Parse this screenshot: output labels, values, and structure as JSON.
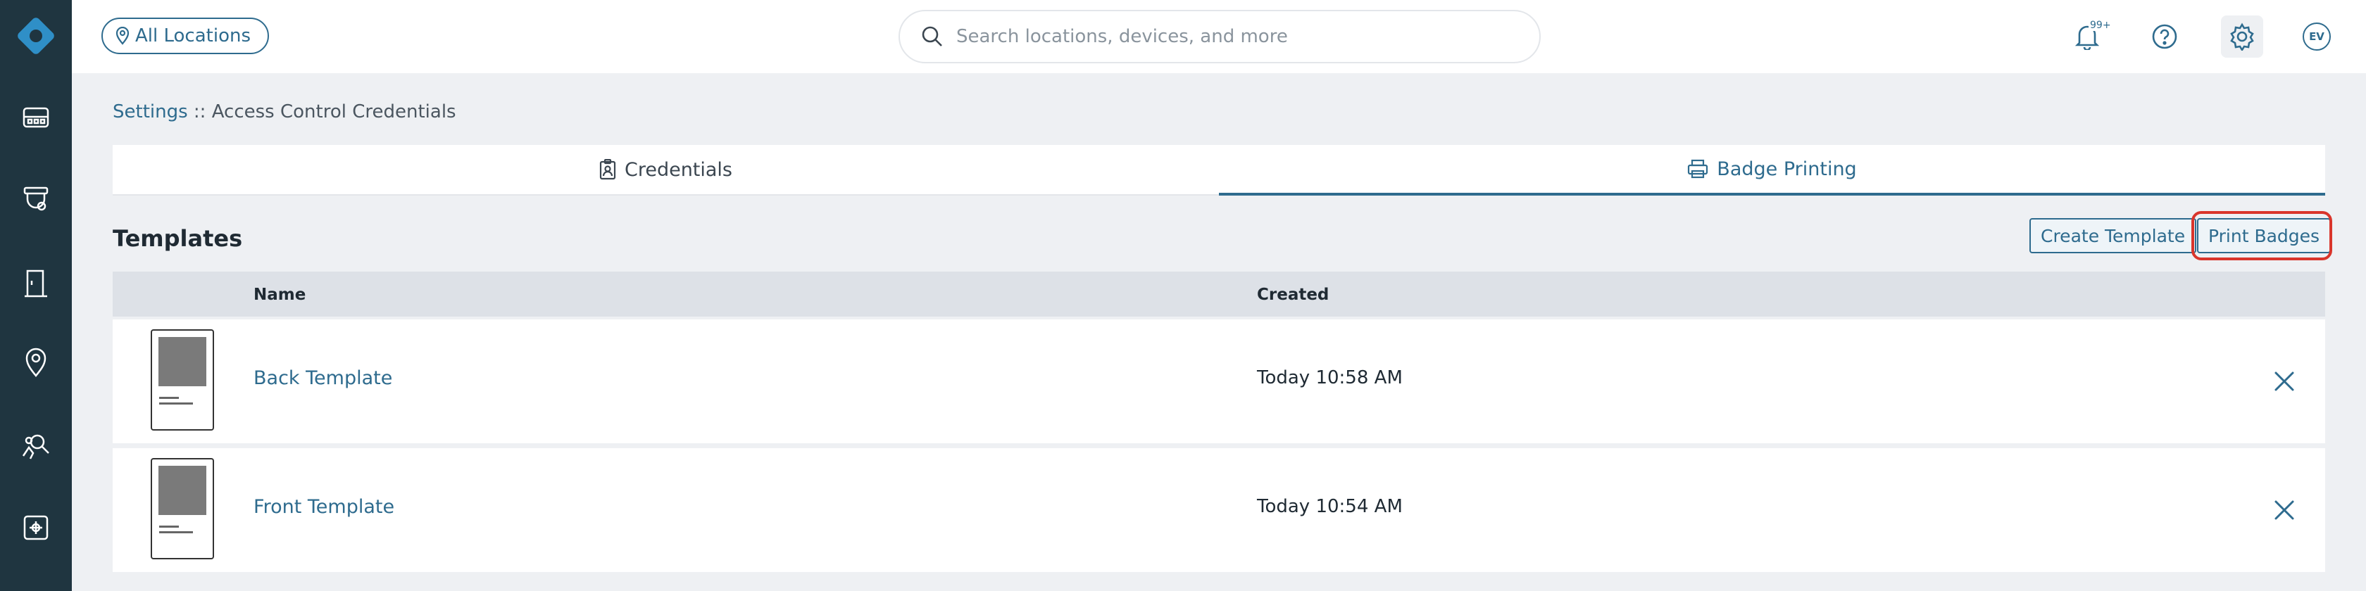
{
  "topbar": {
    "location_label": "All Locations",
    "search_placeholder": "Search locations, devices, and more",
    "notification_count": "99+",
    "avatar_initials": "EV"
  },
  "breadcrumb": {
    "root": "Settings",
    "separator": " :: ",
    "current": "Access Control Credentials"
  },
  "tabs": [
    {
      "label": "Credentials",
      "icon": "badge-icon",
      "active": false
    },
    {
      "label": "Badge Printing",
      "icon": "printer-icon",
      "active": true
    }
  ],
  "templates": {
    "title": "Templates",
    "create_label": "Create Template",
    "print_label": "Print Badges",
    "columns": {
      "name": "Name",
      "created": "Created"
    },
    "rows": [
      {
        "name": "Back Template",
        "created": "Today 10:58 AM"
      },
      {
        "name": "Front Template",
        "created": "Today 10:54 AM"
      }
    ]
  },
  "colors": {
    "sidebar": "#1f3540",
    "accent": "#2e6b8e",
    "highlight_ring": "#d9352b",
    "background": "#eef0f3"
  }
}
